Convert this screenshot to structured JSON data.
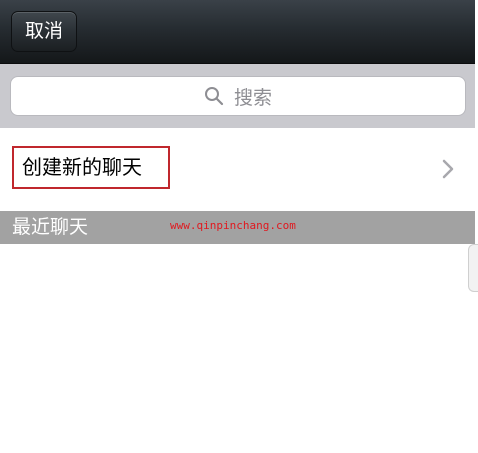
{
  "nav": {
    "cancel_label": "取消"
  },
  "search": {
    "placeholder": "搜索",
    "icon": "search-icon"
  },
  "new_chat": {
    "label": "创建新的聊天",
    "icon": "chevron-right-icon"
  },
  "recent": {
    "title": "最近聊天",
    "watermark": "www.qinpinchang.com"
  },
  "colors": {
    "highlight_border": "#c0272d",
    "watermark": "#e0191f",
    "section_header": "#a2a2a2"
  }
}
